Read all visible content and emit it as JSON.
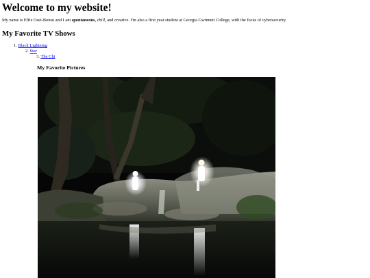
{
  "main_heading": "Welcome to my website!",
  "intro": {
    "part1": "My name is Effie Osei-Bonsu and I am ",
    "spontaneous": "spontaneous",
    "part2": ", ",
    "chill": "chill",
    "part3": ", and creative. I'm also a first year student at Georgia Gwinnett College, with the focus of cybersecurity."
  },
  "shows_heading": "My Favorite TV Shows",
  "shows": [
    {
      "num": "1.",
      "title": "Black Lightning"
    },
    {
      "num": "2.",
      "title": "Star"
    },
    {
      "num": "3.",
      "title": "The Chi"
    }
  ],
  "pictures_heading": "My Favorite Pictures",
  "colors": {
    "link": "#0000ee",
    "text": "#000000"
  }
}
